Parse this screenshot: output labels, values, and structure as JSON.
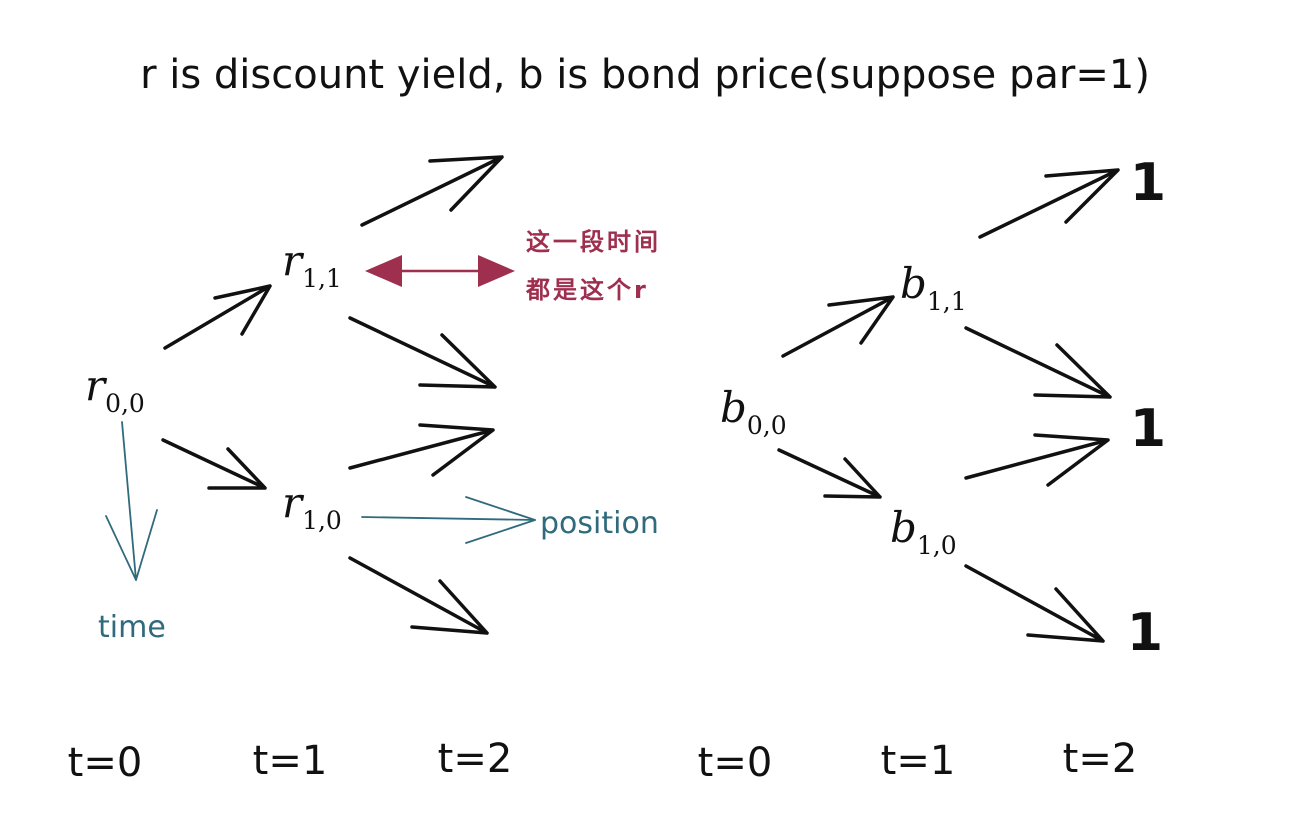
{
  "title": "r is discount yield, b is bond price(suppose par=1)",
  "short_rate_tree": {
    "root": {
      "symbol": "r",
      "subscript": "0,0"
    },
    "up": {
      "symbol": "r",
      "subscript": "1,1"
    },
    "down": {
      "symbol": "r",
      "subscript": "1,0"
    },
    "time_labels": [
      "t=0",
      "t=1",
      "t=2"
    ]
  },
  "bond_price_tree": {
    "root": {
      "symbol": "b",
      "subscript": "0,0"
    },
    "up": {
      "symbol": "b",
      "subscript": "1,1"
    },
    "down": {
      "symbol": "b",
      "subscript": "1,0"
    },
    "terminal_values": [
      "1",
      "1",
      "1"
    ],
    "time_labels": [
      "t=0",
      "t=1",
      "t=2"
    ]
  },
  "annotations": {
    "period_note_line1": "这一段时间",
    "period_note_line2": "都是这个r",
    "time_axis_label": "time",
    "position_axis_label": "position"
  },
  "colors": {
    "ink": "#111111",
    "annotation_red": "#9e2f4f",
    "annotation_teal": "#2f6b7c"
  }
}
